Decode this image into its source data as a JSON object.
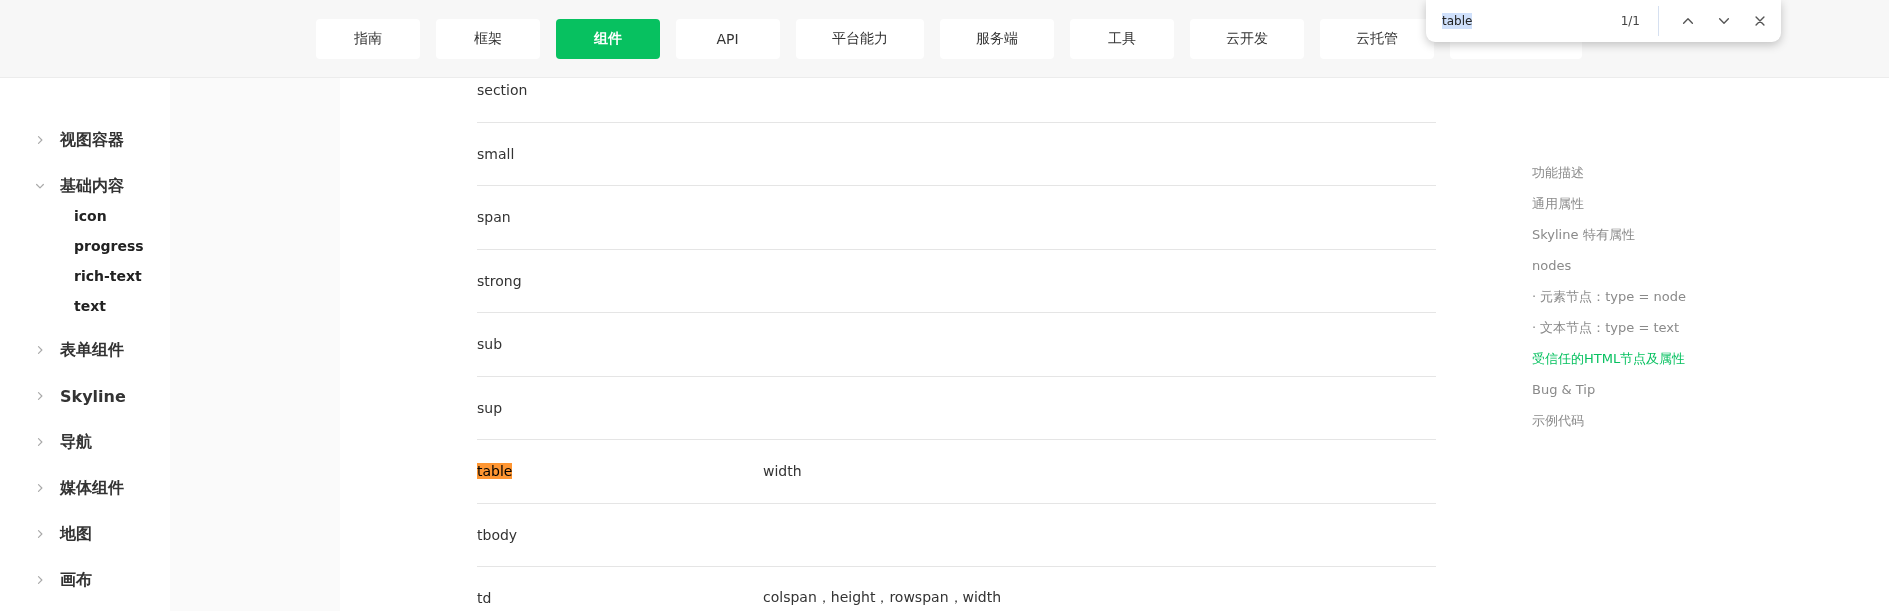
{
  "nav": {
    "tabs": [
      {
        "label": "指南",
        "selected": false
      },
      {
        "label": "框架",
        "selected": false
      },
      {
        "label": "组件",
        "selected": true
      },
      {
        "label": "API",
        "selected": false
      },
      {
        "label": "平台能力",
        "selected": false
      },
      {
        "label": "服务端",
        "selected": false
      },
      {
        "label": "工具",
        "selected": false
      },
      {
        "label": "云开发",
        "selected": false
      },
      {
        "label": "云托管",
        "selected": false
      },
      {
        "selected": false
      }
    ]
  },
  "find_bar": {
    "query": "table",
    "count": "1/1"
  },
  "sidebar": {
    "items": [
      {
        "label": "视图容器",
        "expanded": false
      },
      {
        "label": "基础内容",
        "expanded": true,
        "children": [
          {
            "label": "icon"
          },
          {
            "label": "progress"
          },
          {
            "label": "rich-text"
          },
          {
            "label": "text"
          }
        ]
      },
      {
        "label": "表单组件",
        "expanded": false
      },
      {
        "label": "Skyline",
        "expanded": false
      },
      {
        "label": "导航",
        "expanded": false
      },
      {
        "label": "媒体组件",
        "expanded": false
      },
      {
        "label": "地图",
        "expanded": false
      },
      {
        "label": "画布",
        "expanded": false
      }
    ]
  },
  "table": {
    "rows": [
      {
        "tag": "section",
        "match": false
      },
      {
        "tag": "small",
        "match": false
      },
      {
        "tag": "span",
        "match": false
      },
      {
        "tag": "strong",
        "match": false
      },
      {
        "tag": "sub",
        "match": false
      },
      {
        "tag": "sup",
        "match": false
      },
      {
        "tag": "table",
        "attributes": "width",
        "match": true
      },
      {
        "tag": "tbody",
        "match": false
      },
      {
        "tag": "td",
        "attributes": "colspan，height，rowspan，width",
        "match": false
      }
    ]
  },
  "toc": {
    "items": [
      {
        "label": "功能描述",
        "selected": false
      },
      {
        "label": "通用属性",
        "selected": false
      },
      {
        "label": "Skyline 特有属性",
        "selected": false
      },
      {
        "label": "nodes",
        "selected": false
      },
      {
        "label": "· 元素节点：type = node",
        "selected": false
      },
      {
        "label": "· 文本节点：type = text",
        "selected": false
      },
      {
        "label": "受信任的HTML节点及属性",
        "selected": true
      },
      {
        "label": "Bug & Tip",
        "selected": false
      },
      {
        "label": "示例代码",
        "selected": false
      }
    ]
  }
}
